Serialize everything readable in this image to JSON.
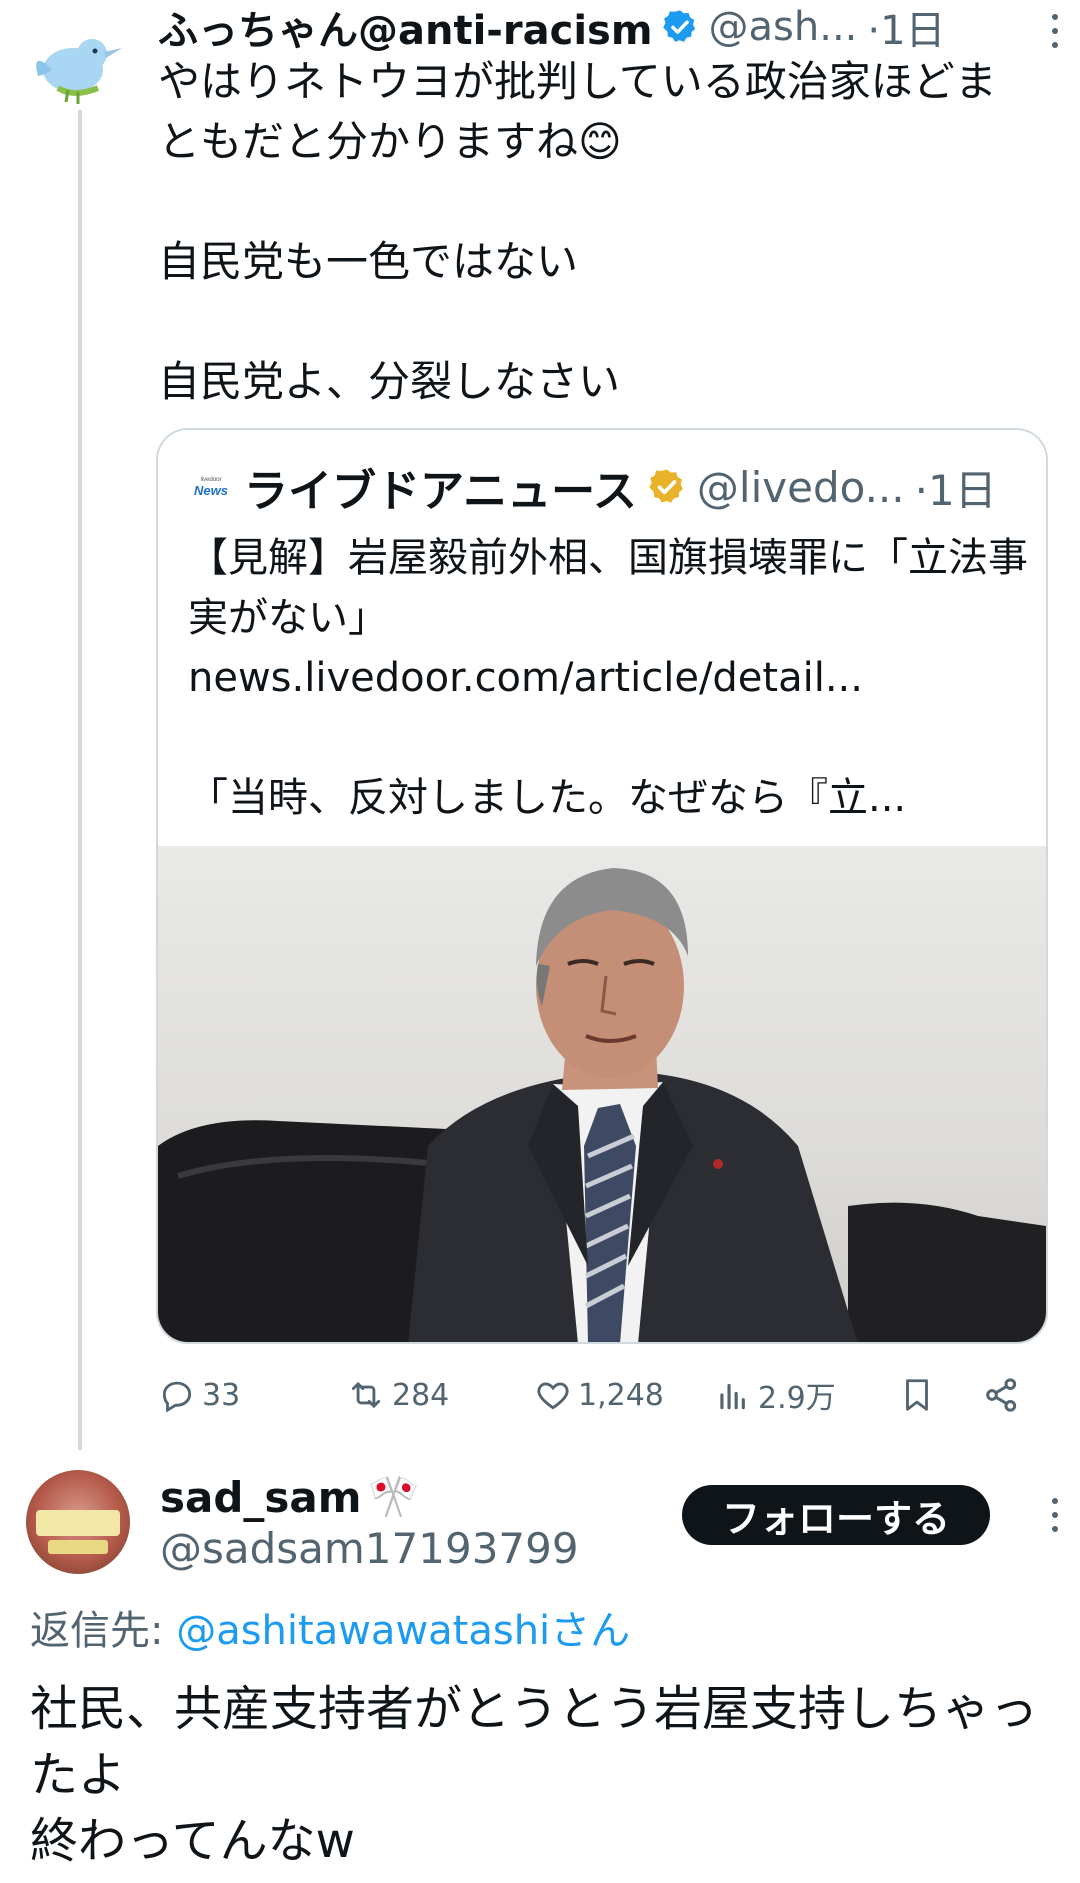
{
  "tweet1": {
    "display_name": "ふっちゃん@anti-racism",
    "handle": "@ash...",
    "time": "·1日",
    "text": "やはりネトウヨが批判している政治家ほどまともだと分かりますね😊\n\n自民党も一色ではない\n\n自民党よ、分裂しなさい",
    "verified_color": "#1d9bf0"
  },
  "quote": {
    "logo_small": "livedoor",
    "logo_text": "News",
    "display_name": "ライブドアニュース",
    "handle": "@livedo...",
    "time": "·1日",
    "text": "【見解】岩屋毅前外相、国旗損壊罪に「立法事実がない」\nnews.livedoor.com/article/detail...\n\n「当時、反対しました。なぜなら『立...",
    "verified_color": "#e8b32a"
  },
  "actions": {
    "replies": "33",
    "reposts": "284",
    "likes": "1,248",
    "views": "2.9万"
  },
  "reply": {
    "display_name": "sad_sam",
    "name_emoji": "🎌",
    "handle": "@sadsam17193799",
    "follow_label": "フォローする",
    "reply_to_prefix": "返信先: ",
    "reply_to_mention": "@ashitawawatashi",
    "reply_to_suffix": "さん",
    "text": "社民、共産支持者がとうとう岩屋支持しちゃったよ\n終わってんなw"
  }
}
